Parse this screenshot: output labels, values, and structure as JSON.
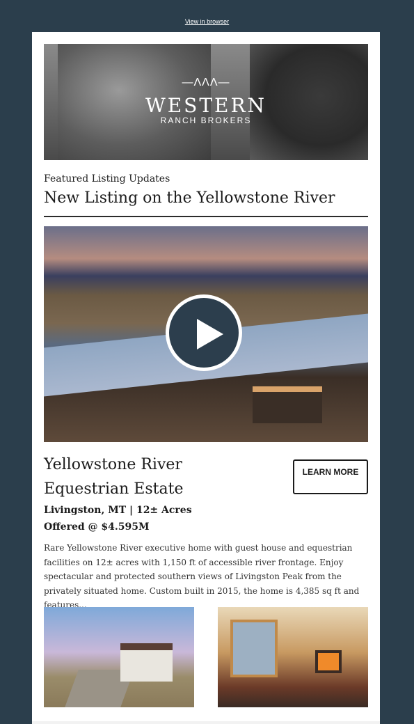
{
  "header": {
    "view_in_browser": "View in browser"
  },
  "hero": {
    "logo_main": "WESTERN",
    "logo_sub": "RANCH BROKERS"
  },
  "section": {
    "eyebrow": "Featured Listing Updates",
    "headline": "New Listing on the Yellowstone River"
  },
  "listing": {
    "title": "Yellowstone River Equestrian Estate",
    "location": "Livingston, MT | 12± Acres",
    "price": "Offered @ $4.595M",
    "description": "Rare Yellowstone River executive home with guest house and equestrian facilities on 12± acres with 1,150 ft of accessible river frontage. Enjoy spectacular and protected southern views of Livingston Peak from the privately situated home. Custom built in 2015, the home is 4,385 sq ft and features...",
    "cta_label": "LEARN MORE"
  },
  "colors": {
    "background": "#2b3e4c",
    "play_button": "#2c3e4d",
    "card": "#ffffff"
  },
  "icons": {
    "play": "play-icon",
    "logo_mark": "logo-mark-icon"
  }
}
